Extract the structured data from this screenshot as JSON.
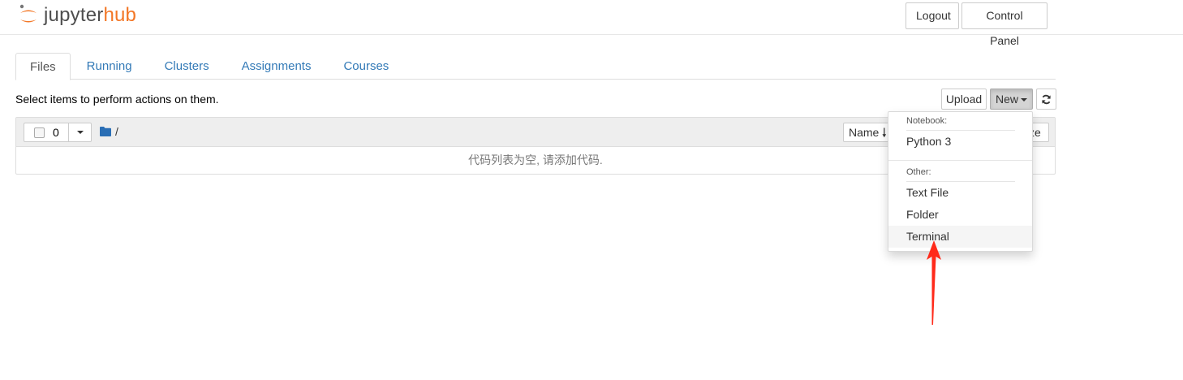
{
  "header": {
    "logo_text_main": "jupyter",
    "logo_text_accent": "hub",
    "logout_label": "Logout",
    "control_panel_label": "Control Panel",
    "accent_color": "#f37726"
  },
  "tabs": [
    {
      "label": "Files",
      "active": true
    },
    {
      "label": "Running",
      "active": false
    },
    {
      "label": "Clusters",
      "active": false
    },
    {
      "label": "Assignments",
      "active": false
    },
    {
      "label": "Courses",
      "active": false
    }
  ],
  "toolbar": {
    "select_hint": "Select items to perform actions on them.",
    "upload_label": "Upload",
    "new_label": "New",
    "refresh_icon": "refresh-icon"
  },
  "file_list": {
    "selected_count": "0",
    "path": "/",
    "sort_name_label": "Name",
    "sort_size_label": "ze",
    "empty_message": "代码列表为空, 请添加代码."
  },
  "new_menu": {
    "notebook_header": "Notebook:",
    "notebook_items": [
      "Python 3"
    ],
    "other_header": "Other:",
    "other_items": [
      "Text File",
      "Folder",
      "Terminal"
    ],
    "highlighted_item": "Terminal"
  },
  "annotation": {
    "arrow_color": "#ff2a1a",
    "points_to": "Terminal"
  }
}
